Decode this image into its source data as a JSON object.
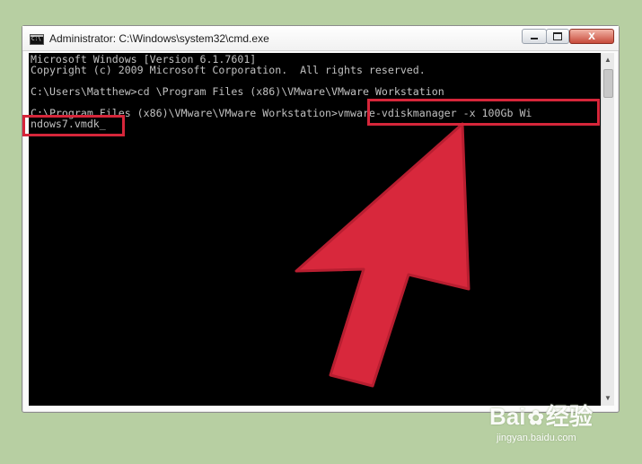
{
  "window": {
    "title": "Administrator: C:\\Windows\\system32\\cmd.exe",
    "close_glyph": "x"
  },
  "console": {
    "lines": [
      "Microsoft Windows [Version 6.1.7601]",
      "Copyright (c) 2009 Microsoft Corporation.  All rights reserved.",
      "",
      "C:\\Users\\Matthew>cd \\Program Files (x86)\\VMware\\VMware Workstation",
      "",
      "C:\\Program Files (x86)\\VMware\\VMware Workstation>vmware-vdiskmanager -x 100Gb Wi",
      "ndows7.vmdk_"
    ]
  },
  "highlight_color": "#d6263a",
  "watermark": {
    "logo": "Bai",
    "logo_suffix": "经验",
    "url": "jingyan.baidu.com"
  }
}
